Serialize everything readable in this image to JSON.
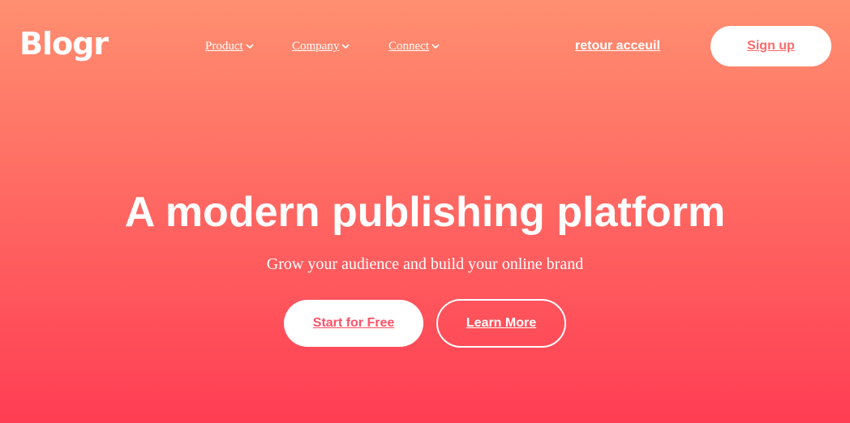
{
  "header": {
    "logo_text": "Blogr",
    "nav": [
      {
        "label": "Product",
        "icon": "chevron-down-icon"
      },
      {
        "label": "Company",
        "icon": "chevron-down-icon"
      },
      {
        "label": "Connect",
        "icon": "chevron-down-icon"
      }
    ],
    "retour_label": "retour acceuil",
    "signup_label": "Sign up"
  },
  "hero": {
    "title": "A modern publishing platform",
    "subtitle": "Grow your audience and build your online brand",
    "primary_cta": "Start for Free",
    "secondary_cta": "Learn More"
  },
  "colors": {
    "gradient_top": "#ff8f70",
    "gradient_bottom": "#ff3d54",
    "accent_text": "#ff5266",
    "white": "#ffffff"
  }
}
